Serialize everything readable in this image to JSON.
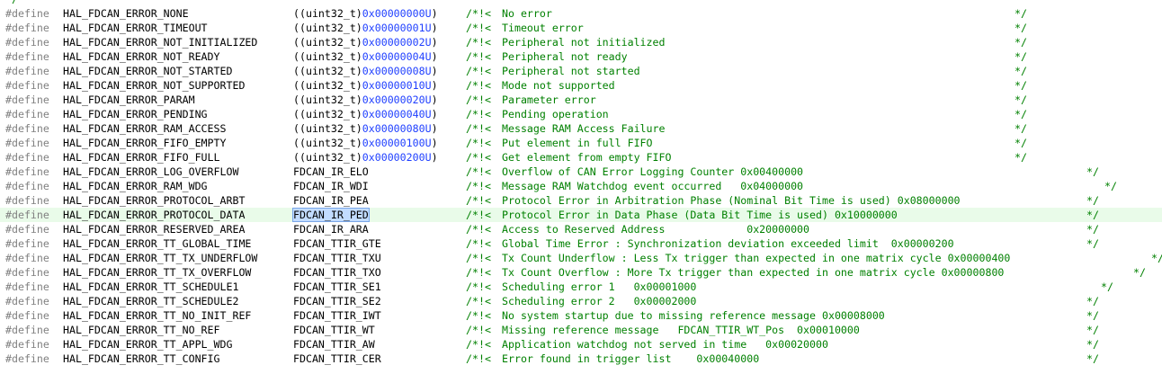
{
  "top_fragment": "*/",
  "rows": [
    {
      "kw": "#define",
      "name": "HAL_FDCAN_ERROR_NONE",
      "cast": "((uint32_t)",
      "hex": "0x00000000U",
      "suffix": ")",
      "cstart": "/*!<",
      "text": "No error",
      "cend": "*/"
    },
    {
      "kw": "#define",
      "name": "HAL_FDCAN_ERROR_TIMEOUT",
      "cast": "((uint32_t)",
      "hex": "0x00000001U",
      "suffix": ")",
      "cstart": "/*!<",
      "text": "Timeout error",
      "cend": "*/"
    },
    {
      "kw": "#define",
      "name": "HAL_FDCAN_ERROR_NOT_INITIALIZED",
      "cast": "((uint32_t)",
      "hex": "0x00000002U",
      "suffix": ")",
      "cstart": "/*!<",
      "text": "Peripheral not initialized",
      "cend": "*/"
    },
    {
      "kw": "#define",
      "name": "HAL_FDCAN_ERROR_NOT_READY",
      "cast": "((uint32_t)",
      "hex": "0x00000004U",
      "suffix": ")",
      "cstart": "/*!<",
      "text": "Peripheral not ready",
      "cend": "*/"
    },
    {
      "kw": "#define",
      "name": "HAL_FDCAN_ERROR_NOT_STARTED",
      "cast": "((uint32_t)",
      "hex": "0x00000008U",
      "suffix": ")",
      "cstart": "/*!<",
      "text": "Peripheral not started",
      "cend": "*/"
    },
    {
      "kw": "#define",
      "name": "HAL_FDCAN_ERROR_NOT_SUPPORTED",
      "cast": "((uint32_t)",
      "hex": "0x00000010U",
      "suffix": ")",
      "cstart": "/*!<",
      "text": "Mode not supported",
      "cend": "*/"
    },
    {
      "kw": "#define",
      "name": "HAL_FDCAN_ERROR_PARAM",
      "cast": "((uint32_t)",
      "hex": "0x00000020U",
      "suffix": ")",
      "cstart": "/*!<",
      "text": "Parameter error",
      "cend": "*/"
    },
    {
      "kw": "#define",
      "name": "HAL_FDCAN_ERROR_PENDING",
      "cast": "((uint32_t)",
      "hex": "0x00000040U",
      "suffix": ")",
      "cstart": "/*!<",
      "text": "Pending operation",
      "cend": "*/"
    },
    {
      "kw": "#define",
      "name": "HAL_FDCAN_ERROR_RAM_ACCESS",
      "cast": "((uint32_t)",
      "hex": "0x00000080U",
      "suffix": ")",
      "cstart": "/*!<",
      "text": "Message RAM Access Failure",
      "cend": "*/"
    },
    {
      "kw": "#define",
      "name": "HAL_FDCAN_ERROR_FIFO_EMPTY",
      "cast": "((uint32_t)",
      "hex": "0x00000100U",
      "suffix": ")",
      "cstart": "/*!<",
      "text": "Put element in full FIFO",
      "cend": "*/"
    },
    {
      "kw": "#define",
      "name": "HAL_FDCAN_ERROR_FIFO_FULL",
      "cast": "((uint32_t)",
      "hex": "0x00000200U",
      "suffix": ")",
      "cstart": "/*!<",
      "text": "Get element from empty FIFO",
      "cend": "*/"
    },
    {
      "kw": "#define",
      "name": "HAL_FDCAN_ERROR_LOG_OVERFLOW",
      "value": "FDCAN_IR_ELO",
      "cstart": "/*!<",
      "text": "Overflow of CAN Error Logging Counter 0x00400000",
      "cend": "*/"
    },
    {
      "kw": "#define",
      "name": "HAL_FDCAN_ERROR_RAM_WDG",
      "value": "FDCAN_IR_WDI",
      "cstart": "/*!<",
      "text": "Message RAM Watchdog event occurred   0x04000000",
      "cend": "*/"
    },
    {
      "kw": "#define",
      "name": "HAL_FDCAN_ERROR_PROTOCOL_ARBT",
      "value": "FDCAN_IR_PEA",
      "cstart": "/*!<",
      "text": "Protocol Error in Arbitration Phase (Nominal Bit Time is used) 0x08000000",
      "cend": "*/"
    },
    {
      "kw": "#define",
      "name": "HAL_FDCAN_ERROR_PROTOCOL_DATA",
      "value": "FDCAN_IR_PED",
      "cstart": "/*!<",
      "text": "Protocol Error in Data Phase (Data Bit Time is used) 0x10000000",
      "cend": "*/"
    },
    {
      "kw": "#define",
      "name": "HAL_FDCAN_ERROR_RESERVED_AREA",
      "value": "FDCAN_IR_ARA",
      "cstart": "/*!<",
      "text": "Access to Reserved Address             0x20000000",
      "cend": "*/"
    },
    {
      "kw": "#define",
      "name": "HAL_FDCAN_ERROR_TT_GLOBAL_TIME",
      "value": "FDCAN_TTIR_GTE",
      "cstart": "/*!<",
      "text": "Global Time Error : Synchronization deviation exceeded limit  0x00000200",
      "cend": "*/"
    },
    {
      "kw": "#define",
      "name": "HAL_FDCAN_ERROR_TT_TX_UNDERFLOW",
      "value": "FDCAN_TTIR_TXU",
      "cstart": "/*!<",
      "text": "Tx Count Underflow : Less Tx trigger than expected in one matrix cycle 0x00000400",
      "cend": "*/"
    },
    {
      "kw": "#define",
      "name": "HAL_FDCAN_ERROR_TT_TX_OVERFLOW",
      "value": "FDCAN_TTIR_TXO",
      "cstart": "/*!<",
      "text": "Tx Count Overflow : More Tx trigger than expected in one matrix cycle 0x00000800",
      "cend": "*/"
    },
    {
      "kw": "#define",
      "name": "HAL_FDCAN_ERROR_TT_SCHEDULE1",
      "value": "FDCAN_TTIR_SE1",
      "cstart": "/*!<",
      "text": "Scheduling error 1   0x00001000",
      "cend": "*/"
    },
    {
      "kw": "#define",
      "name": "HAL_FDCAN_ERROR_TT_SCHEDULE2",
      "value": "FDCAN_TTIR_SE2",
      "cstart": "/*!<",
      "text": "Scheduling error 2   0x00002000",
      "cend": "*/"
    },
    {
      "kw": "#define",
      "name": "HAL_FDCAN_ERROR_TT_NO_INIT_REF",
      "value": "FDCAN_TTIR_IWT",
      "cstart": "/*!<",
      "text": "No system startup due to missing reference message 0x00008000",
      "cend": "*/"
    },
    {
      "kw": "#define",
      "name": "HAL_FDCAN_ERROR_TT_NO_REF",
      "value": "FDCAN_TTIR_WT",
      "cstart": "/*!<",
      "text": "Missing reference message   FDCAN_TTIR_WT_Pos  0x00010000",
      "cend": "*/"
    },
    {
      "kw": "#define",
      "name": "HAL_FDCAN_ERROR_TT_APPL_WDG",
      "value": "FDCAN_TTIR_AW",
      "cstart": "/*!<",
      "text": "Application watchdog not served in time   0x00020000",
      "cend": "*/"
    },
    {
      "kw": "#define",
      "name": "HAL_FDCAN_ERROR_TT_CONFIG",
      "value": "FDCAN_TTIR_CER",
      "cstart": "/*!<",
      "text": "Error found in trigger list    0x00040000",
      "cend": "*/"
    }
  ],
  "highlighted_row": 14,
  "selected_token": "FDCAN_IR_PED"
}
